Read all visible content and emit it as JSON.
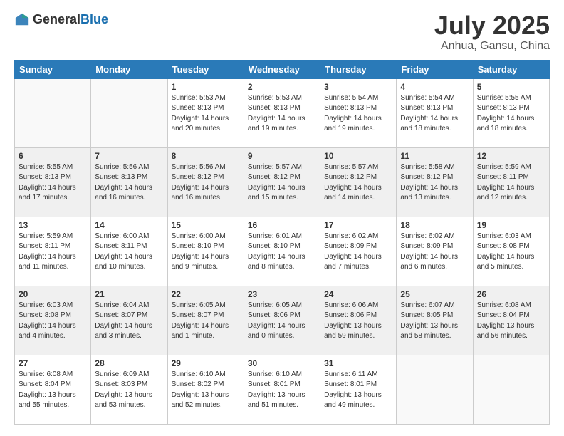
{
  "header": {
    "logo_general": "General",
    "logo_blue": "Blue",
    "title": "July 2025",
    "location": "Anhua, Gansu, China"
  },
  "weekdays": [
    "Sunday",
    "Monday",
    "Tuesday",
    "Wednesday",
    "Thursday",
    "Friday",
    "Saturday"
  ],
  "weeks": [
    [
      {
        "day": "",
        "empty": true
      },
      {
        "day": "",
        "empty": true
      },
      {
        "day": "1",
        "sunrise": "Sunrise: 5:53 AM",
        "sunset": "Sunset: 8:13 PM",
        "daylight": "Daylight: 14 hours and 20 minutes."
      },
      {
        "day": "2",
        "sunrise": "Sunrise: 5:53 AM",
        "sunset": "Sunset: 8:13 PM",
        "daylight": "Daylight: 14 hours and 19 minutes."
      },
      {
        "day": "3",
        "sunrise": "Sunrise: 5:54 AM",
        "sunset": "Sunset: 8:13 PM",
        "daylight": "Daylight: 14 hours and 19 minutes."
      },
      {
        "day": "4",
        "sunrise": "Sunrise: 5:54 AM",
        "sunset": "Sunset: 8:13 PM",
        "daylight": "Daylight: 14 hours and 18 minutes."
      },
      {
        "day": "5",
        "sunrise": "Sunrise: 5:55 AM",
        "sunset": "Sunset: 8:13 PM",
        "daylight": "Daylight: 14 hours and 18 minutes."
      }
    ],
    [
      {
        "day": "6",
        "sunrise": "Sunrise: 5:55 AM",
        "sunset": "Sunset: 8:13 PM",
        "daylight": "Daylight: 14 hours and 17 minutes."
      },
      {
        "day": "7",
        "sunrise": "Sunrise: 5:56 AM",
        "sunset": "Sunset: 8:13 PM",
        "daylight": "Daylight: 14 hours and 16 minutes."
      },
      {
        "day": "8",
        "sunrise": "Sunrise: 5:56 AM",
        "sunset": "Sunset: 8:12 PM",
        "daylight": "Daylight: 14 hours and 16 minutes."
      },
      {
        "day": "9",
        "sunrise": "Sunrise: 5:57 AM",
        "sunset": "Sunset: 8:12 PM",
        "daylight": "Daylight: 14 hours and 15 minutes."
      },
      {
        "day": "10",
        "sunrise": "Sunrise: 5:57 AM",
        "sunset": "Sunset: 8:12 PM",
        "daylight": "Daylight: 14 hours and 14 minutes."
      },
      {
        "day": "11",
        "sunrise": "Sunrise: 5:58 AM",
        "sunset": "Sunset: 8:12 PM",
        "daylight": "Daylight: 14 hours and 13 minutes."
      },
      {
        "day": "12",
        "sunrise": "Sunrise: 5:59 AM",
        "sunset": "Sunset: 8:11 PM",
        "daylight": "Daylight: 14 hours and 12 minutes."
      }
    ],
    [
      {
        "day": "13",
        "sunrise": "Sunrise: 5:59 AM",
        "sunset": "Sunset: 8:11 PM",
        "daylight": "Daylight: 14 hours and 11 minutes."
      },
      {
        "day": "14",
        "sunrise": "Sunrise: 6:00 AM",
        "sunset": "Sunset: 8:11 PM",
        "daylight": "Daylight: 14 hours and 10 minutes."
      },
      {
        "day": "15",
        "sunrise": "Sunrise: 6:00 AM",
        "sunset": "Sunset: 8:10 PM",
        "daylight": "Daylight: 14 hours and 9 minutes."
      },
      {
        "day": "16",
        "sunrise": "Sunrise: 6:01 AM",
        "sunset": "Sunset: 8:10 PM",
        "daylight": "Daylight: 14 hours and 8 minutes."
      },
      {
        "day": "17",
        "sunrise": "Sunrise: 6:02 AM",
        "sunset": "Sunset: 8:09 PM",
        "daylight": "Daylight: 14 hours and 7 minutes."
      },
      {
        "day": "18",
        "sunrise": "Sunrise: 6:02 AM",
        "sunset": "Sunset: 8:09 PM",
        "daylight": "Daylight: 14 hours and 6 minutes."
      },
      {
        "day": "19",
        "sunrise": "Sunrise: 6:03 AM",
        "sunset": "Sunset: 8:08 PM",
        "daylight": "Daylight: 14 hours and 5 minutes."
      }
    ],
    [
      {
        "day": "20",
        "sunrise": "Sunrise: 6:03 AM",
        "sunset": "Sunset: 8:08 PM",
        "daylight": "Daylight: 14 hours and 4 minutes."
      },
      {
        "day": "21",
        "sunrise": "Sunrise: 6:04 AM",
        "sunset": "Sunset: 8:07 PM",
        "daylight": "Daylight: 14 hours and 3 minutes."
      },
      {
        "day": "22",
        "sunrise": "Sunrise: 6:05 AM",
        "sunset": "Sunset: 8:07 PM",
        "daylight": "Daylight: 14 hours and 1 minute."
      },
      {
        "day": "23",
        "sunrise": "Sunrise: 6:05 AM",
        "sunset": "Sunset: 8:06 PM",
        "daylight": "Daylight: 14 hours and 0 minutes."
      },
      {
        "day": "24",
        "sunrise": "Sunrise: 6:06 AM",
        "sunset": "Sunset: 8:06 PM",
        "daylight": "Daylight: 13 hours and 59 minutes."
      },
      {
        "day": "25",
        "sunrise": "Sunrise: 6:07 AM",
        "sunset": "Sunset: 8:05 PM",
        "daylight": "Daylight: 13 hours and 58 minutes."
      },
      {
        "day": "26",
        "sunrise": "Sunrise: 6:08 AM",
        "sunset": "Sunset: 8:04 PM",
        "daylight": "Daylight: 13 hours and 56 minutes."
      }
    ],
    [
      {
        "day": "27",
        "sunrise": "Sunrise: 6:08 AM",
        "sunset": "Sunset: 8:04 PM",
        "daylight": "Daylight: 13 hours and 55 minutes."
      },
      {
        "day": "28",
        "sunrise": "Sunrise: 6:09 AM",
        "sunset": "Sunset: 8:03 PM",
        "daylight": "Daylight: 13 hours and 53 minutes."
      },
      {
        "day": "29",
        "sunrise": "Sunrise: 6:10 AM",
        "sunset": "Sunset: 8:02 PM",
        "daylight": "Daylight: 13 hours and 52 minutes."
      },
      {
        "day": "30",
        "sunrise": "Sunrise: 6:10 AM",
        "sunset": "Sunset: 8:01 PM",
        "daylight": "Daylight: 13 hours and 51 minutes."
      },
      {
        "day": "31",
        "sunrise": "Sunrise: 6:11 AM",
        "sunset": "Sunset: 8:01 PM",
        "daylight": "Daylight: 13 hours and 49 minutes."
      },
      {
        "day": "",
        "empty": true
      },
      {
        "day": "",
        "empty": true
      }
    ]
  ]
}
